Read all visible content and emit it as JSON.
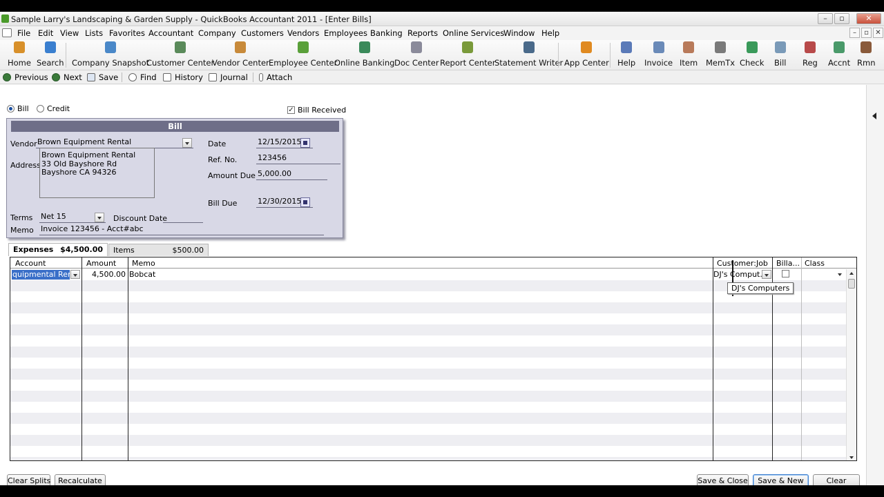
{
  "window": {
    "title": "Sample Larry's Landscaping & Garden Supply  - QuickBooks Accountant 2011 - [Enter Bills]",
    "controls": [
      "–",
      "▫",
      "✕"
    ]
  },
  "menu": {
    "items": [
      "File",
      "Edit",
      "View",
      "Lists",
      "Favorites",
      "Accountant",
      "Company",
      "Customers",
      "Vendors",
      "Employees",
      "Banking",
      "Reports",
      "Online Services",
      "Window",
      "Help"
    ],
    "mdi_controls": [
      "–",
      "▫",
      "✕"
    ]
  },
  "toolbar": {
    "items": [
      {
        "label": "Home",
        "icon": "home-icon",
        "color": "#d8902a"
      },
      {
        "label": "Search",
        "icon": "search-icon",
        "color": "#3a7fcf"
      },
      {
        "label": "Company Snapshot",
        "icon": "snapshot-icon",
        "color": "#4a88c8"
      },
      {
        "label": "Customer Center",
        "icon": "customer-center-icon",
        "color": "#5a8a5a"
      },
      {
        "label": "Vendor Center",
        "icon": "vendor-center-icon",
        "color": "#c88a3a"
      },
      {
        "label": "Employee Center",
        "icon": "employee-center-icon",
        "color": "#5aa03a"
      },
      {
        "label": "Online Banking",
        "icon": "online-banking-icon",
        "color": "#3a8a5a"
      },
      {
        "label": "Doc Center",
        "icon": "doc-center-icon",
        "color": "#8a8a9a"
      },
      {
        "label": "Report Center",
        "icon": "report-center-icon",
        "color": "#7a9a3a"
      },
      {
        "label": "Statement Writer",
        "icon": "statement-writer-icon",
        "color": "#4a6a8a"
      },
      {
        "label": "App Center",
        "icon": "app-center-icon",
        "color": "#e08a20"
      },
      {
        "label": "Help",
        "icon": "help-icon",
        "color": "#5a7ab8"
      },
      {
        "label": "Invoice",
        "icon": "invoice-icon",
        "color": "#6a8ab8"
      },
      {
        "label": "Item",
        "icon": "item-icon",
        "color": "#b87a5a"
      },
      {
        "label": "MemTx",
        "icon": "memtx-icon",
        "color": "#7a7a7a"
      },
      {
        "label": "Check",
        "icon": "check-icon",
        "color": "#3a9a5a"
      },
      {
        "label": "Bill",
        "icon": "bill-icon",
        "color": "#7a9ab8"
      },
      {
        "label": "Reg",
        "icon": "register-icon",
        "color": "#b84a4a"
      },
      {
        "label": "Accnt",
        "icon": "accounts-icon",
        "color": "#4a9a6a"
      },
      {
        "label": "Rmn",
        "icon": "reminders-icon",
        "color": "#8a5a3a"
      }
    ]
  },
  "form_toolbar": {
    "previous": "Previous",
    "next": "Next",
    "save": "Save",
    "find": "Find",
    "history": "History",
    "journal": "Journal",
    "attach": "Attach"
  },
  "bill_type": {
    "bill_label": "Bill",
    "credit_label": "Credit",
    "selected": "Bill",
    "bill_received_label": "Bill Received",
    "bill_received_checked": true
  },
  "bill": {
    "header": "Bill",
    "vendor_label": "Vendor",
    "vendor": "Brown Equipment Rental",
    "address_label": "Address",
    "address_lines": [
      "Brown Equipment Rental",
      "33 Old Bayshore Rd",
      "Bayshore CA 94326"
    ],
    "date_label": "Date",
    "date": "12/15/2015",
    "ref_label": "Ref. No.",
    "ref_no": "123456",
    "amount_due_label": "Amount Due",
    "amount_due": "5,000.00",
    "bill_due_label": "Bill Due",
    "bill_due": "12/30/2015",
    "terms_label": "Terms",
    "terms": "Net 15",
    "discount_date_label": "Discount Date",
    "discount_date": "",
    "memo_label": "Memo",
    "memo": "Invoice 123456 - Acct#abc"
  },
  "tabs": {
    "expenses_label": "Expenses",
    "expenses_amount": "$4,500.00",
    "items_label": "Items",
    "items_amount": "$500.00"
  },
  "expenses_grid": {
    "columns": {
      "account": "Account",
      "amount": "Amount",
      "memo": "Memo",
      "customer_job": "Customer:Job",
      "billable": "Billa...",
      "class": "Class"
    },
    "row": {
      "account": "quipmental Rental",
      "amount": "4,500.00",
      "memo": "Bobcat",
      "customer_job": "DJ's Comput...",
      "billable": false,
      "class": ""
    },
    "tooltip": "DJ's Computers"
  },
  "buttons": {
    "clear_splits": "Clear Splits",
    "recalculate": "Recalculate",
    "save_close": "Save & Close",
    "save_new": "Save & New",
    "clear": "Clear"
  }
}
